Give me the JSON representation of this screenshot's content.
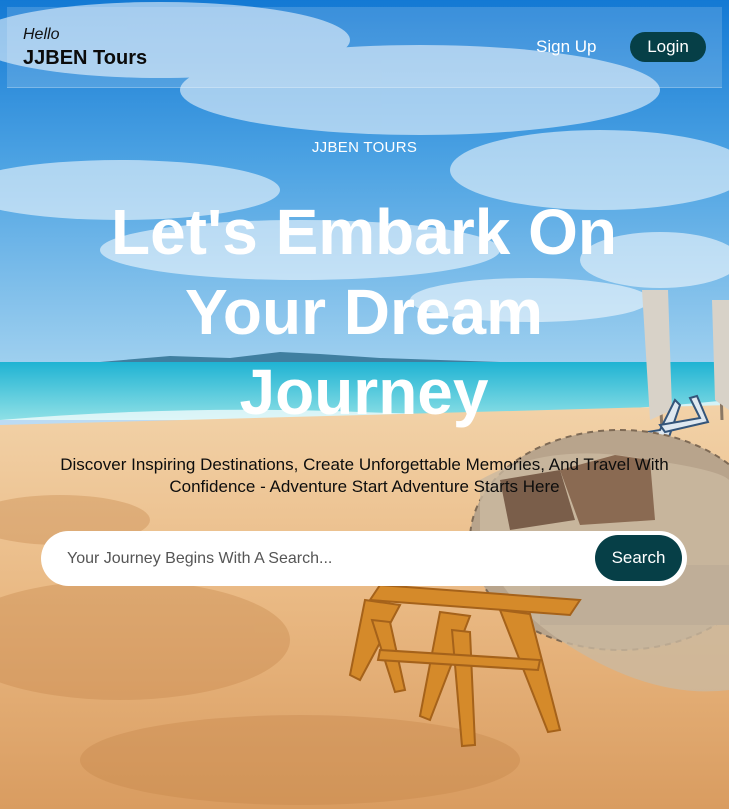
{
  "header": {
    "greeting": "Hello",
    "brand": "JJBEN Tours",
    "signup_label": "Sign Up",
    "login_label": "Login"
  },
  "hero": {
    "eyebrow": "JJBEN TOURS",
    "headline": "Let's Embark On Your Dream Journey",
    "subtext": "Discover Inspiring Destinations, Create Unforgettable Memories, And Travel With Confidence - Adventure Start Adventure Starts Here",
    "background_icon": "beach-photo"
  },
  "search": {
    "placeholder": "Your Journey Begins With A Search...",
    "button_label": "Search"
  },
  "colors": {
    "accent": "#063f47",
    "sky": "#1f86d6",
    "sand": "#e8b883",
    "sea": "#3cc2d8"
  }
}
